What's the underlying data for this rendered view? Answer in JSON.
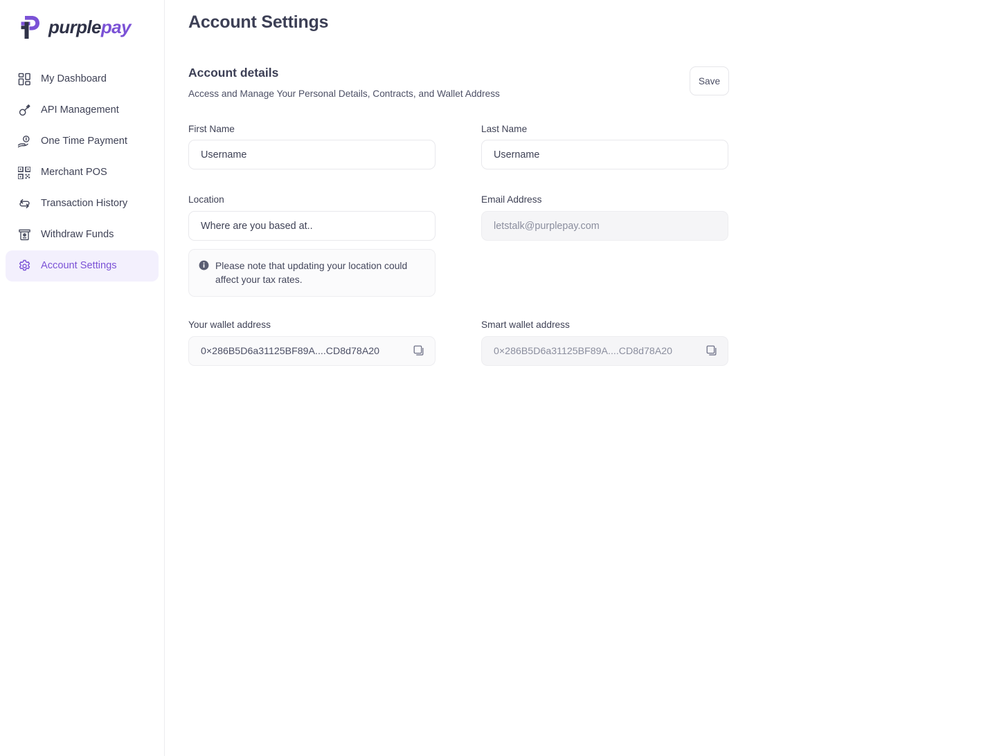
{
  "brand": {
    "name_part1": "purple",
    "name_part2": "pay",
    "logo_icon": "purplepay-p-logo",
    "accent": "#7b52d6",
    "text_dark": "#2f3247"
  },
  "sidebar": {
    "items": [
      {
        "label": "My Dashboard",
        "icon": "dashboard-grid-icon",
        "active": false
      },
      {
        "label": "API Management",
        "icon": "key-icon",
        "active": false
      },
      {
        "label": "One Time Payment",
        "icon": "hand-coin-icon",
        "active": false
      },
      {
        "label": "Merchant POS",
        "icon": "qr-code-icon",
        "active": false
      },
      {
        "label": "Transaction History",
        "icon": "swap-arrows-icon",
        "active": false
      },
      {
        "label": "Withdraw Funds",
        "icon": "atm-icon",
        "active": false
      },
      {
        "label": "Account Settings",
        "icon": "gear-icon",
        "active": true
      }
    ],
    "active_bg": "#f3f0fd",
    "active_fg": "#7b52d6"
  },
  "page": {
    "title": "Account Settings"
  },
  "section": {
    "title": "Account details",
    "subtitle": "Access and Manage Your Personal Details, Contracts, and Wallet Address",
    "save_label": "Save"
  },
  "form": {
    "first_name": {
      "label": "First Name",
      "value": "Username",
      "placeholder": "Username"
    },
    "last_name": {
      "label": "Last Name",
      "value": "Username",
      "placeholder": "Username"
    },
    "location": {
      "label": "Location",
      "value": "Where are you based at..",
      "placeholder": "Where are you based at.."
    },
    "email": {
      "label": "Email Address",
      "value": "letstalk@purplepay.com",
      "placeholder": "letstalk@purplepay.com",
      "disabled": true
    },
    "location_note": {
      "icon": "info-icon",
      "text": "Please note that updating your location could affect your tax rates."
    },
    "your_wallet": {
      "label": "Your wallet address",
      "value": "0×286B5D6a31125BF89A....CD8d78A20",
      "copy_icon": "copy-icon"
    },
    "smart_wallet": {
      "label": "Smart wallet address",
      "value": "0×286B5D6a31125BF89A....CD8d78A20",
      "copy_icon": "copy-icon"
    }
  }
}
